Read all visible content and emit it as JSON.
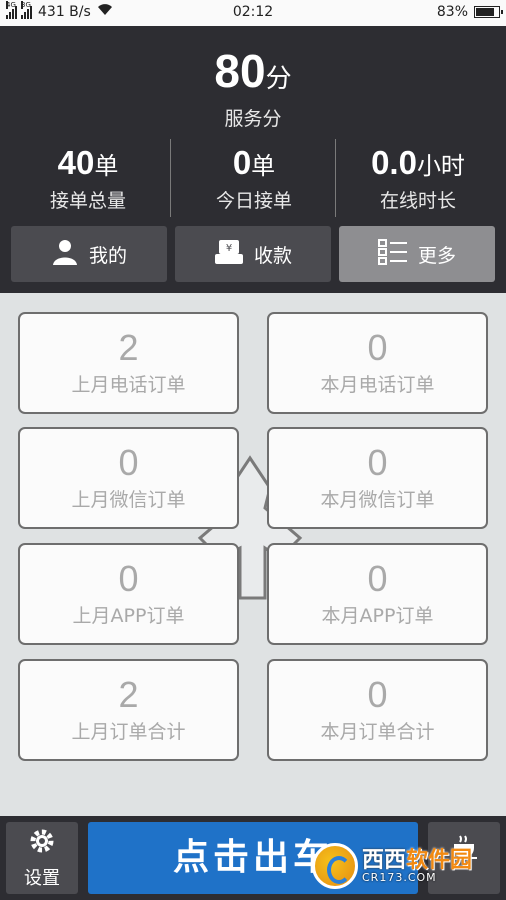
{
  "status_bar": {
    "sim1": "4G",
    "sim2": "3G",
    "speed": "431 B/s",
    "time": "02:12",
    "battery": "83%",
    "battery_level": 0.83
  },
  "header": {
    "score_value": "80",
    "score_unit": "分",
    "score_label": "服务分",
    "stats": [
      {
        "value": "40",
        "unit": "单",
        "label": "接单总量"
      },
      {
        "value": "0",
        "unit": "单",
        "label": "今日接单"
      },
      {
        "value": "0.0",
        "unit": "小时",
        "label": "在线时长"
      }
    ],
    "buttons": [
      {
        "label": "我的",
        "icon": "user-icon"
      },
      {
        "label": "收款",
        "icon": "payment-icon"
      },
      {
        "label": "更多",
        "icon": "list-icon"
      }
    ]
  },
  "stats_grid": [
    {
      "value": "2",
      "label": "上月电话订单"
    },
    {
      "value": "0",
      "label": "本月电话订单"
    },
    {
      "value": "0",
      "label": "上月微信订单"
    },
    {
      "value": "0",
      "label": "本月微信订单"
    },
    {
      "value": "0",
      "label": "上月APP订单"
    },
    {
      "value": "0",
      "label": "本月APP订单"
    },
    {
      "value": "2",
      "label": "上月订单合计"
    },
    {
      "value": "0",
      "label": "本月订单合计"
    }
  ],
  "bottom_bar": {
    "settings_label": "设置",
    "depart_label": "点击出车",
    "coffee_icon": "coffee-icon"
  },
  "watermark": {
    "title_a": "西西",
    "title_b": "软件园",
    "subtitle": "CR173.COM"
  }
}
